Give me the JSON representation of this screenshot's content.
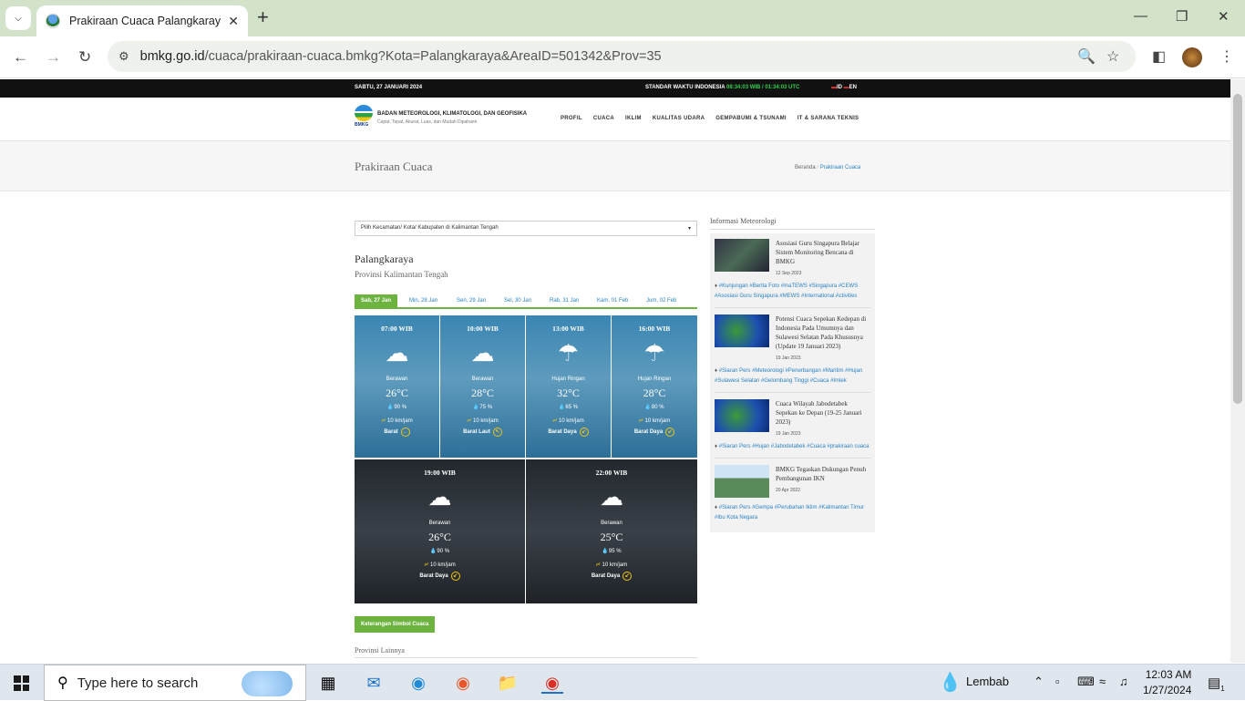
{
  "browser": {
    "tab_title": "Prakiraan Cuaca Palangkaraya -",
    "url_domain": "bmkg.go.id",
    "url_path": "/cuaca/prakiraan-cuaca.bmkg?Kota=Palangkaraya&AreaID=501342&Prov=35"
  },
  "site": {
    "date": "SABTU, 27 JANUARI 2024",
    "clock_label": "STANDAR WAKTU INDONESIA",
    "clock_time": "08:34:03 WIB / 01:34:03 UTC",
    "lang_id": "ID",
    "lang_en": "EN",
    "logo_text": "BMKG",
    "org_name": "BADAN METEOROLOGI, KLIMATOLOGI, DAN GEOFISIKA",
    "org_slogan": "Cepat, Tepat, Akurat, Luas, dan Mudah Dipahami",
    "menu": [
      "PROFIL",
      "CUACA",
      "IKLIM",
      "KUALITAS UDARA",
      "GEMPABUMI & TSUNAMI",
      "IT & SARANA TEKNIS"
    ],
    "page_title": "Prakiraan Cuaca",
    "crumb_home": "Beranda",
    "crumb_sep": "/",
    "crumb_current": "Prakiraan Cuaca"
  },
  "forecast": {
    "select_placeholder": "Pilih Kecamatan/ Kota/ Kabupaten di Kalimantan Tengah",
    "city": "Palangkaraya",
    "province": "Provinsi Kalimantan Tengah",
    "days": [
      "Sab, 27 Jan",
      "Min, 28 Jan",
      "Sen, 29 Jan",
      "Sel, 30 Jan",
      "Rab, 31 Jan",
      "Kam, 01 Feb",
      "Jum, 02 Feb"
    ],
    "cards": [
      {
        "time": "07:00 WIB",
        "cond": "Berawan",
        "temp": "26°C",
        "hum": "90 %",
        "wind": "10 km/jam",
        "dir": "Barat",
        "icon": "cloud-icon"
      },
      {
        "time": "10:00 WIB",
        "cond": "Berawan",
        "temp": "28°C",
        "hum": "75 %",
        "wind": "10 km/jam",
        "dir": "Barat Laut",
        "icon": "cloud-icon"
      },
      {
        "time": "13:00 WIB",
        "cond": "Hujan Ringan",
        "temp": "32°C",
        "hum": "65 %",
        "wind": "10 km/jam",
        "dir": "Barat Daya",
        "icon": "rain-icon"
      },
      {
        "time": "16:00 WIB",
        "cond": "Hujan Ringan",
        "temp": "28°C",
        "hum": "80 %",
        "wind": "10 km/jam",
        "dir": "Barat Daya",
        "icon": "rain-icon"
      },
      {
        "time": "19:00 WIB",
        "cond": "Berawan",
        "temp": "26°C",
        "hum": "90 %",
        "wind": "10 km/jam",
        "dir": "Barat Daya",
        "icon": "cloud-icon"
      },
      {
        "time": "22:00 WIB",
        "cond": "Berawan",
        "temp": "25°C",
        "hum": "95 %",
        "wind": "10 km/jam",
        "dir": "Barat Daya",
        "icon": "cloud-icon"
      }
    ],
    "legend_button": "Keterangan Simbol Cuaca",
    "other_provinces": "Provinsi Lainnya"
  },
  "sidebar": {
    "heading": "Informasi Meteorologi",
    "news": [
      {
        "title": "Asosiasi Guru Singapura Belajar Sistem Monitoring Bencana di BMKG",
        "date": "12 Sep 2023",
        "tags": "#Kunjungan #Berita Foto #InaTEWS #Singapura #CEWS #Asosiasi Guru Singapura #MEWS #International Activities"
      },
      {
        "title": "Potensi Cuaca Sepekan Kedepan di Indonesia Pada Umumnya dan Sulawesi Selatan Pada Khususnya (Update 19 Januari 2023)",
        "date": "19 Jan 2023",
        "tags": "#Siaran Pers #Meteorologi #Penerbangan #Maritim #Hujan #Sulawesi Selatan #Gelombang Tinggi #Cuaca #Imlek"
      },
      {
        "title": "Cuaca Wilayah Jabodetabek Sepekan ke Depan (19-25 Januari 2023)",
        "date": "19 Jan 2023",
        "tags": "#Siaran Pers #Hujan #Jabodetabek #Cuaca #prakiraan cuaca"
      },
      {
        "title": "BMKG Tegaskan Dukungan Penuh Pembangunan IKN",
        "date": "20 Apr 2022",
        "tags": "#Siaran Pers #Gempa #Perubahan Iklim #Kalimantan Timur #Ibu Kota Negara"
      }
    ]
  },
  "taskbar": {
    "search_placeholder": "Type here to search",
    "weather": "Lembab",
    "time": "12:03 AM",
    "date": "1/27/2024",
    "notif_count": "1"
  }
}
